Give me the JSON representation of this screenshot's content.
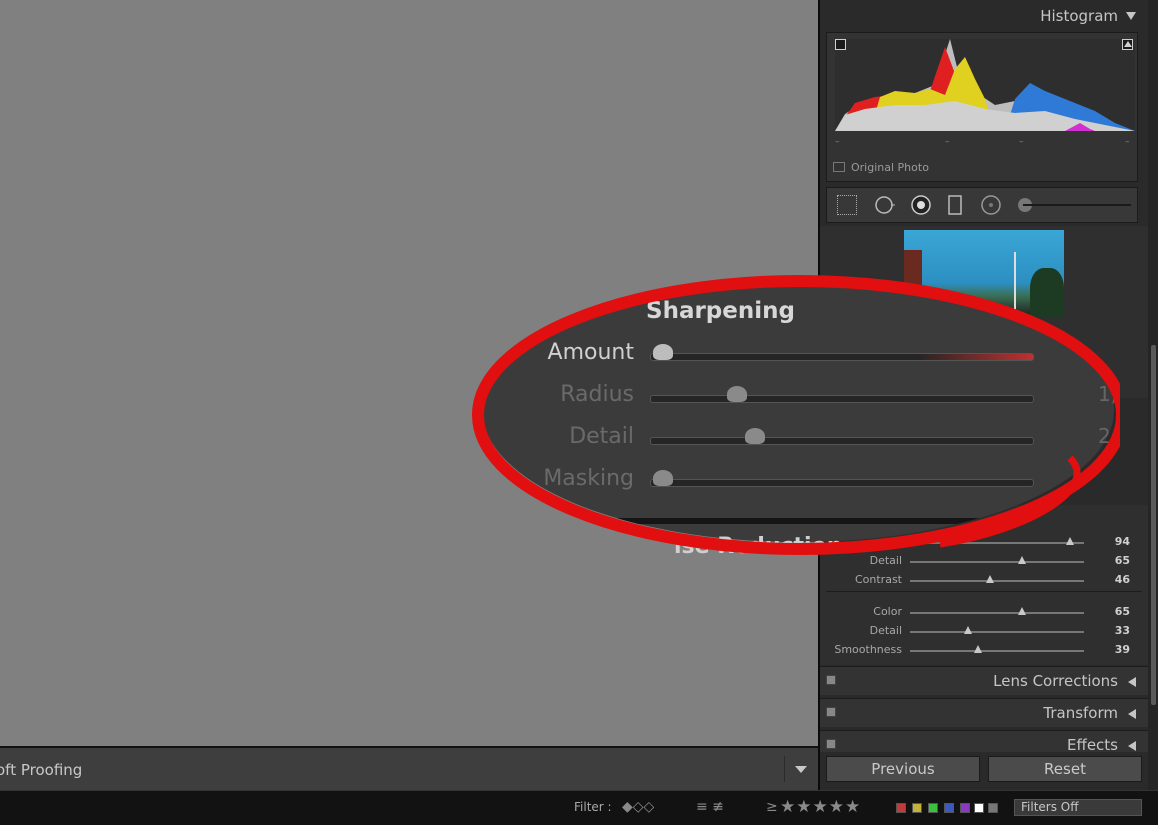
{
  "toolbar": {
    "label": "oft Proofing"
  },
  "histogram": {
    "title": "Histogram",
    "original_photo_label": "Original Photo",
    "tick_marks": [
      "–",
      "–",
      "–",
      "–"
    ]
  },
  "sharpening": {
    "title": "Sharpening",
    "rows": [
      {
        "label": "Amount",
        "value": "",
        "level": 0.0
      },
      {
        "label": "Radius",
        "value": "1,",
        "level": 0.2
      },
      {
        "label": "Detail",
        "value": "2",
        "level": 0.25
      },
      {
        "label": "Masking",
        "value": "",
        "level": 0.0
      }
    ]
  },
  "noise_reduction": {
    "title_partial": "ise Reduction",
    "luminance": [
      {
        "label": "",
        "value": "94",
        "level": 0.93
      },
      {
        "label": "Detail",
        "value": "65",
        "level": 0.65
      },
      {
        "label": "Contrast",
        "value": "46",
        "level": 0.46
      }
    ],
    "color": [
      {
        "label": "Color",
        "value": "65",
        "level": 0.65
      },
      {
        "label": "Detail",
        "value": "33",
        "level": 0.33
      },
      {
        "label": "Smoothness",
        "value": "39",
        "level": 0.39
      }
    ]
  },
  "sections": [
    "Lens Corrections",
    "Transform",
    "Effects"
  ],
  "buttons": {
    "previous": "Previous",
    "reset": "Reset"
  },
  "filter": {
    "label": "Filter :",
    "comparator": "≥",
    "stars": "★★★★★",
    "color_labels": [
      "#c23a3a",
      "#c2b13a",
      "#3ac23f",
      "#3a5ac2",
      "#8a3ac2",
      "#ffffff",
      "#777777"
    ],
    "dropdown": "Filters Off"
  },
  "colors": {
    "annotation_red": "#e10f0f"
  }
}
